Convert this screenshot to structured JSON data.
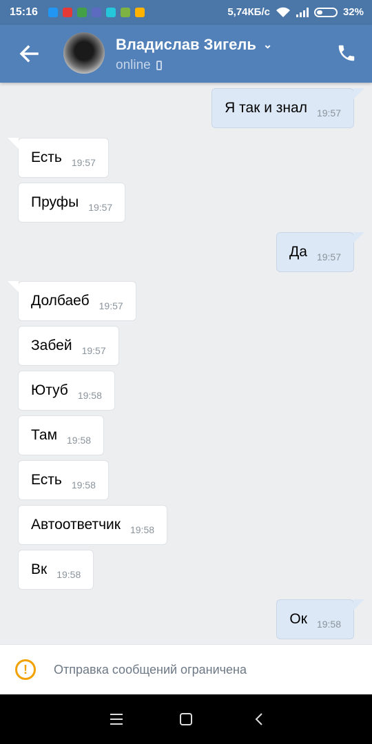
{
  "status_bar": {
    "time": "15:16",
    "net_speed": "5,74КБ/с",
    "battery": "32%",
    "battery_level": 0.32
  },
  "header": {
    "contact_name": "Владислав Зигель",
    "status": "online"
  },
  "messages": [
    {
      "direction": "out",
      "text": "Я так и знал",
      "time": "19:57"
    },
    {
      "direction": "in",
      "text": "Есть",
      "time": "19:57"
    },
    {
      "direction": "in",
      "text": "Пруфы",
      "time": "19:57"
    },
    {
      "direction": "out",
      "text": "Да",
      "time": "19:57"
    },
    {
      "direction": "in",
      "text": "Долбаеб",
      "time": "19:57"
    },
    {
      "direction": "in",
      "text": "Забей",
      "time": "19:57"
    },
    {
      "direction": "in",
      "text": "Ютуб",
      "time": "19:58"
    },
    {
      "direction": "in",
      "text": "Там",
      "time": "19:58"
    },
    {
      "direction": "in",
      "text": "Есть",
      "time": "19:58"
    },
    {
      "direction": "in",
      "text": "Автоответчик",
      "time": "19:58"
    },
    {
      "direction": "in",
      "text": "Вк",
      "time": "19:58"
    },
    {
      "direction": "out",
      "text": "Ок",
      "time": "19:58"
    }
  ],
  "footer": {
    "notice": "Отправка сообщений ограничена"
  },
  "colors": {
    "header_bg": "#5181b8",
    "status_bar_bg": "#4a76a8",
    "outgoing_bubble": "#dde8f6",
    "incoming_bubble": "#ffffff",
    "warning": "#f2a100"
  },
  "icons": [
    "back-arrow-icon",
    "chevron-down-icon",
    "mobile-phone-icon",
    "call-icon",
    "warning-icon",
    "menu-icon",
    "home-icon",
    "nav-back-icon"
  ]
}
